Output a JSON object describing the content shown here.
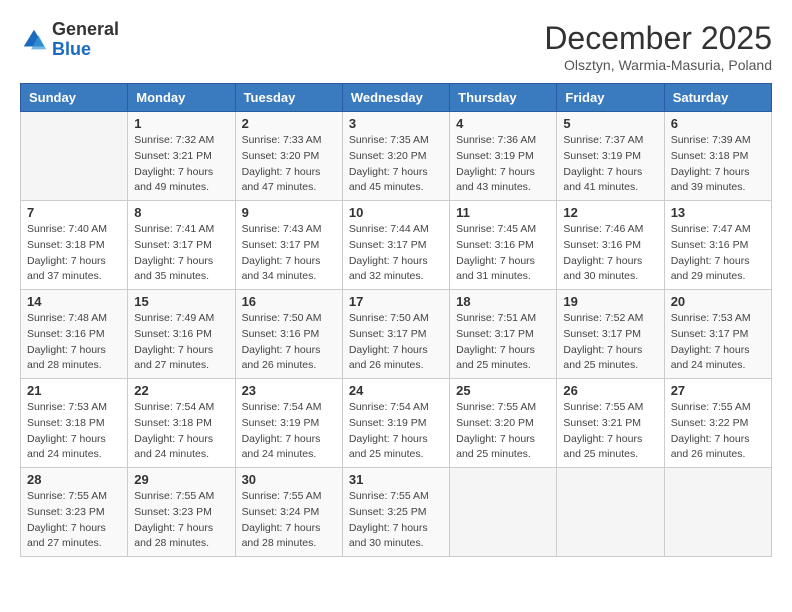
{
  "header": {
    "logo_general": "General",
    "logo_blue": "Blue",
    "month_title": "December 2025",
    "subtitle": "Olsztyn, Warmia-Masuria, Poland"
  },
  "weekdays": [
    "Sunday",
    "Monday",
    "Tuesday",
    "Wednesday",
    "Thursday",
    "Friday",
    "Saturday"
  ],
  "weeks": [
    [
      {
        "day": "",
        "info": ""
      },
      {
        "day": "1",
        "info": "Sunrise: 7:32 AM\nSunset: 3:21 PM\nDaylight: 7 hours\nand 49 minutes."
      },
      {
        "day": "2",
        "info": "Sunrise: 7:33 AM\nSunset: 3:20 PM\nDaylight: 7 hours\nand 47 minutes."
      },
      {
        "day": "3",
        "info": "Sunrise: 7:35 AM\nSunset: 3:20 PM\nDaylight: 7 hours\nand 45 minutes."
      },
      {
        "day": "4",
        "info": "Sunrise: 7:36 AM\nSunset: 3:19 PM\nDaylight: 7 hours\nand 43 minutes."
      },
      {
        "day": "5",
        "info": "Sunrise: 7:37 AM\nSunset: 3:19 PM\nDaylight: 7 hours\nand 41 minutes."
      },
      {
        "day": "6",
        "info": "Sunrise: 7:39 AM\nSunset: 3:18 PM\nDaylight: 7 hours\nand 39 minutes."
      }
    ],
    [
      {
        "day": "7",
        "info": "Sunrise: 7:40 AM\nSunset: 3:18 PM\nDaylight: 7 hours\nand 37 minutes."
      },
      {
        "day": "8",
        "info": "Sunrise: 7:41 AM\nSunset: 3:17 PM\nDaylight: 7 hours\nand 35 minutes."
      },
      {
        "day": "9",
        "info": "Sunrise: 7:43 AM\nSunset: 3:17 PM\nDaylight: 7 hours\nand 34 minutes."
      },
      {
        "day": "10",
        "info": "Sunrise: 7:44 AM\nSunset: 3:17 PM\nDaylight: 7 hours\nand 32 minutes."
      },
      {
        "day": "11",
        "info": "Sunrise: 7:45 AM\nSunset: 3:16 PM\nDaylight: 7 hours\nand 31 minutes."
      },
      {
        "day": "12",
        "info": "Sunrise: 7:46 AM\nSunset: 3:16 PM\nDaylight: 7 hours\nand 30 minutes."
      },
      {
        "day": "13",
        "info": "Sunrise: 7:47 AM\nSunset: 3:16 PM\nDaylight: 7 hours\nand 29 minutes."
      }
    ],
    [
      {
        "day": "14",
        "info": "Sunrise: 7:48 AM\nSunset: 3:16 PM\nDaylight: 7 hours\nand 28 minutes."
      },
      {
        "day": "15",
        "info": "Sunrise: 7:49 AM\nSunset: 3:16 PM\nDaylight: 7 hours\nand 27 minutes."
      },
      {
        "day": "16",
        "info": "Sunrise: 7:50 AM\nSunset: 3:16 PM\nDaylight: 7 hours\nand 26 minutes."
      },
      {
        "day": "17",
        "info": "Sunrise: 7:50 AM\nSunset: 3:17 PM\nDaylight: 7 hours\nand 26 minutes."
      },
      {
        "day": "18",
        "info": "Sunrise: 7:51 AM\nSunset: 3:17 PM\nDaylight: 7 hours\nand 25 minutes."
      },
      {
        "day": "19",
        "info": "Sunrise: 7:52 AM\nSunset: 3:17 PM\nDaylight: 7 hours\nand 25 minutes."
      },
      {
        "day": "20",
        "info": "Sunrise: 7:53 AM\nSunset: 3:17 PM\nDaylight: 7 hours\nand 24 minutes."
      }
    ],
    [
      {
        "day": "21",
        "info": "Sunrise: 7:53 AM\nSunset: 3:18 PM\nDaylight: 7 hours\nand 24 minutes."
      },
      {
        "day": "22",
        "info": "Sunrise: 7:54 AM\nSunset: 3:18 PM\nDaylight: 7 hours\nand 24 minutes."
      },
      {
        "day": "23",
        "info": "Sunrise: 7:54 AM\nSunset: 3:19 PM\nDaylight: 7 hours\nand 24 minutes."
      },
      {
        "day": "24",
        "info": "Sunrise: 7:54 AM\nSunset: 3:19 PM\nDaylight: 7 hours\nand 25 minutes."
      },
      {
        "day": "25",
        "info": "Sunrise: 7:55 AM\nSunset: 3:20 PM\nDaylight: 7 hours\nand 25 minutes."
      },
      {
        "day": "26",
        "info": "Sunrise: 7:55 AM\nSunset: 3:21 PM\nDaylight: 7 hours\nand 25 minutes."
      },
      {
        "day": "27",
        "info": "Sunrise: 7:55 AM\nSunset: 3:22 PM\nDaylight: 7 hours\nand 26 minutes."
      }
    ],
    [
      {
        "day": "28",
        "info": "Sunrise: 7:55 AM\nSunset: 3:23 PM\nDaylight: 7 hours\nand 27 minutes."
      },
      {
        "day": "29",
        "info": "Sunrise: 7:55 AM\nSunset: 3:23 PM\nDaylight: 7 hours\nand 28 minutes."
      },
      {
        "day": "30",
        "info": "Sunrise: 7:55 AM\nSunset: 3:24 PM\nDaylight: 7 hours\nand 28 minutes."
      },
      {
        "day": "31",
        "info": "Sunrise: 7:55 AM\nSunset: 3:25 PM\nDaylight: 7 hours\nand 30 minutes."
      },
      {
        "day": "",
        "info": ""
      },
      {
        "day": "",
        "info": ""
      },
      {
        "day": "",
        "info": ""
      }
    ]
  ]
}
